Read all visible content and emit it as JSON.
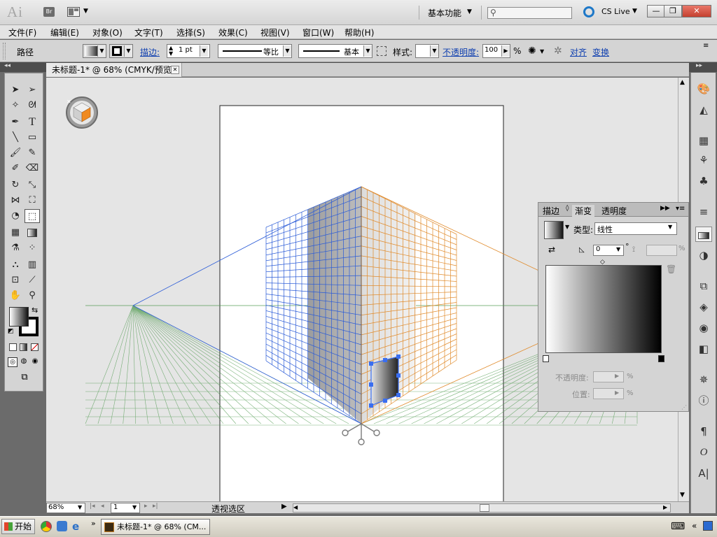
{
  "app": {
    "logo": "Ai",
    "bridge_label": "Br",
    "workspace": "基本功能",
    "search_placeholder": "",
    "cs_live": "CS Live",
    "min_label": "—",
    "restore_label": "❐",
    "close_label": "✕"
  },
  "menu": [
    "文件(F)",
    "编辑(E)",
    "对象(O)",
    "文字(T)",
    "选择(S)",
    "效果(C)",
    "视图(V)",
    "窗口(W)",
    "帮助(H)"
  ],
  "control": {
    "selection_type": "路径",
    "stroke_label": "描边:",
    "stroke_weight": "1 pt",
    "profile_label": "等比",
    "brush_label": "基本",
    "style_label": "样式:",
    "opacity_label": "不透明度:",
    "opacity_value": "100",
    "opacity_unit": "%",
    "align_label": "对齐",
    "transform_label": "变换"
  },
  "document": {
    "tab_title": "未标题-1* @ 68% (CMYK/预览)",
    "tab_close": "✕"
  },
  "status": {
    "zoom": "68%",
    "page": "1",
    "tool_status": "透视选区"
  },
  "gradient_panel": {
    "tabs": [
      "描边",
      "渐变",
      "透明度"
    ],
    "type_label": "类型:",
    "type_value": "线性",
    "angle_value": "0",
    "degree_symbol": "°",
    "aspect_unit": "%",
    "opacity_label": "不透明度:",
    "location_label": "位置:",
    "percent": "%"
  },
  "taskbar": {
    "start_label": "开始",
    "window_label": "未标题-1* @ 68% (CM...",
    "tray_label": "«"
  },
  "colors": {
    "left_plane": "#2a5bd7",
    "right_plane": "#e08a2a",
    "ground_plane": "#4f9a4f",
    "accent": "#1e78c8"
  }
}
